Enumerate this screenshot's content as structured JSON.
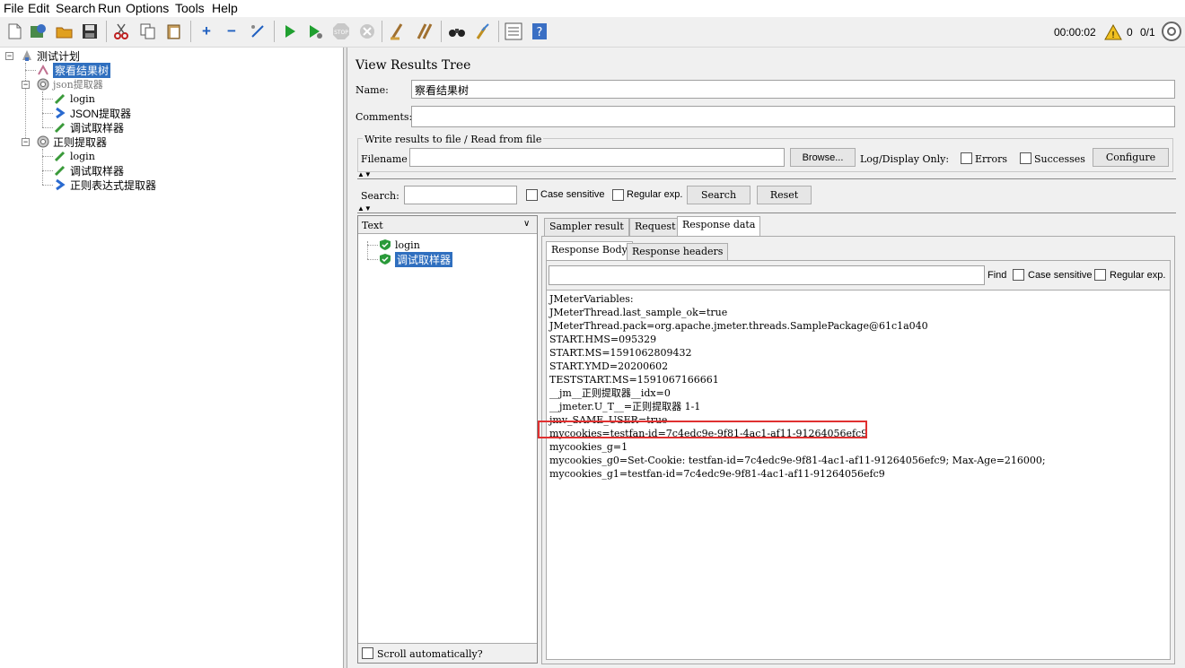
{
  "menu": [
    "File",
    "Edit",
    "Search",
    "Run",
    "Options",
    "Tools",
    "Help"
  ],
  "toolbar": {
    "timer": "00:00:02",
    "warn_count": "0",
    "threads": "0/1"
  },
  "tree": {
    "root": "测试计划",
    "items": [
      {
        "label": "察看结果树",
        "selected": true
      },
      {
        "label": "json提取器"
      },
      {
        "label": "login"
      },
      {
        "label": "JSON提取器"
      },
      {
        "label": "调试取样器"
      },
      {
        "label": "正则提取器"
      },
      {
        "label": "login"
      },
      {
        "label": "调试取样器"
      },
      {
        "label": "正则表达式提取器"
      }
    ]
  },
  "panel": {
    "title": "View Results Tree",
    "name_label": "Name:",
    "name_value": "察看结果树",
    "comments_label": "Comments:",
    "write_group": "Write results to file / Read from file",
    "filename_label": "Filename",
    "browse": "Browse...",
    "log_display": "Log/Display Only:",
    "errors": "Errors",
    "successes": "Successes",
    "configure": "Configure",
    "search_label": "Search:",
    "case_sensitive": "Case sensitive",
    "regular_exp": "Regular exp.",
    "search_btn": "Search",
    "reset_btn": "Reset",
    "renderer": "Text",
    "results": [
      "login",
      "调试取样器"
    ],
    "scroll_auto": "Scroll automatically?",
    "tabs": [
      "Sampler result",
      "Request",
      "Response data"
    ],
    "subtabs": [
      "Response Body",
      "Response headers"
    ],
    "find": "Find",
    "find_case": "Case sensitive",
    "find_regex": "Regular exp."
  },
  "response_lines": [
    "JMeterVariables:",
    "JMeterThread.last_sample_ok=true",
    "JMeterThread.pack=org.apache.jmeter.threads.SamplePackage@61c1a040",
    "START.HMS=095329",
    "START.MS=1591062809432",
    "START.YMD=20200602",
    "TESTSTART.MS=1591067166661",
    "__jm__正则提取器__idx=0",
    "__jmeter.U_T__=正则提取器 1-1",
    "jmv_SAME_USER=true",
    "mycookies=testfan-id=7c4edc9e-9f81-4ac1-af11-91264056efc9",
    "mycookies_g=1",
    "mycookies_g0=Set-Cookie: testfan-id=7c4edc9e-9f81-4ac1-af11-91264056efc9; Max-Age=216000;",
    "mycookies_g1=testfan-id=7c4edc9e-9f81-4ac1-af11-91264056efc9"
  ]
}
